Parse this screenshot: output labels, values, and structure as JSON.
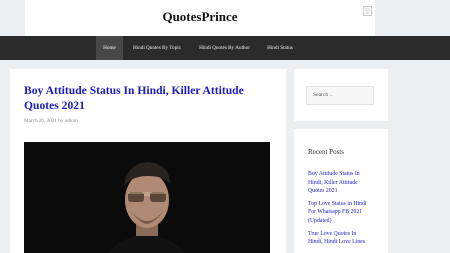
{
  "site": {
    "title": "QuotesPrince"
  },
  "nav": {
    "items": [
      {
        "label": "Home"
      },
      {
        "label": "Hindi Quotes By Topic"
      },
      {
        "label": "Hindi Quotes By Author"
      },
      {
        "label": "Hindi Status"
      }
    ]
  },
  "post": {
    "title": "Boy Attitude Status In Hindi, Killer Attitude Quotes 2021",
    "meta": "March 26, 2021 by admin"
  },
  "sidebar": {
    "search_placeholder": "Search ...",
    "recent_title": "Recent Posts",
    "recent_posts": [
      {
        "label": "Boy Attitude Status In Hindi, Killer Attitude Quotes 2021"
      },
      {
        "label": "Top Love Status in Hindi For Whatsapp FB 2021 (Updated)"
      },
      {
        "label": "True Love Quotes In Hindi, Hindi Love Lines"
      }
    ]
  }
}
